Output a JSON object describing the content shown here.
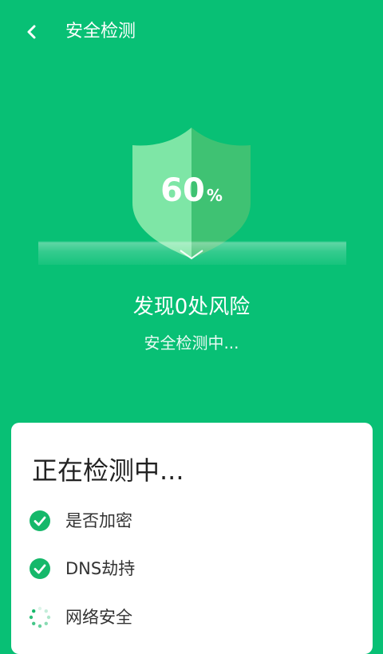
{
  "header": {
    "title": "安全检测",
    "back_icon": "chevron-left-icon"
  },
  "scan": {
    "percent_value": "60",
    "percent_sign": "%",
    "progress": 0.6,
    "risk_text": "发现0处风险",
    "status_text": "安全检测中..."
  },
  "card": {
    "title": "正在检测中...",
    "items": [
      {
        "label": "是否加密",
        "state": "done",
        "icon": "check-circle-icon"
      },
      {
        "label": "DNS劫持",
        "state": "done",
        "icon": "check-circle-icon"
      },
      {
        "label": "网络安全",
        "state": "loading",
        "icon": "loading-spinner-icon"
      }
    ]
  },
  "colors": {
    "background": "#08C075",
    "shield_light": "#7EE6A6",
    "shield_dark": "#3FC273",
    "check_green": "#15B86A",
    "text_dark": "#222222"
  }
}
